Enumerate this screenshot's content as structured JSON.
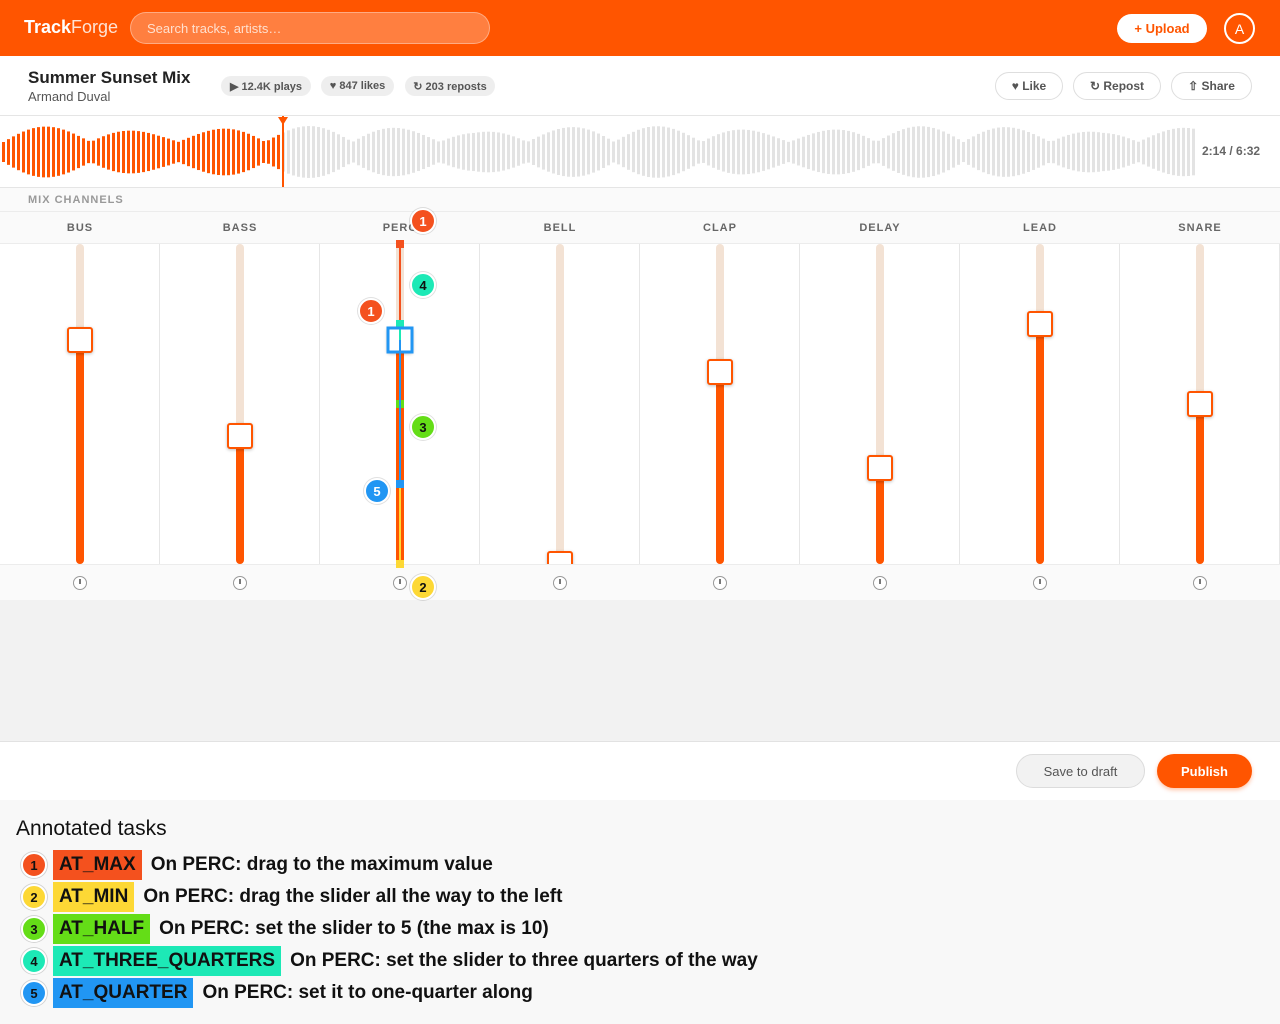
{
  "header": {
    "logo_bold": "Track",
    "logo_light": "Forge",
    "search_placeholder": "Search tracks, artists…",
    "upload_label": "+ Upload",
    "avatar_letter": "A"
  },
  "track": {
    "title": "Summer Sunset Mix",
    "artist": "Armand Duval",
    "plays": "▶ 12.4K plays",
    "likes": "♥ 847 likes",
    "reposts": "↻ 203 reposts",
    "actions": {
      "like": "♥ Like",
      "repost": "↻ Repost",
      "share": "⇧ Share"
    }
  },
  "waveform": {
    "time": "2:14 / 6:32",
    "progress": 0.352
  },
  "mix": {
    "section_label": "MIX CHANNELS",
    "channels": [
      {
        "name": "BUS",
        "level": 0.7
      },
      {
        "name": "BASS",
        "level": 0.4
      },
      {
        "name": "PERC",
        "level": 0.7
      },
      {
        "name": "BELL",
        "level": 0.0
      },
      {
        "name": "CLAP",
        "level": 0.6
      },
      {
        "name": "DELAY",
        "level": 0.3
      },
      {
        "name": "LEAD",
        "level": 0.75
      },
      {
        "name": "SNARE",
        "level": 0.5
      }
    ]
  },
  "footer": {
    "save_label": "Save to draft",
    "publish_label": "Publish"
  },
  "annotations": {
    "title": "Annotated tasks",
    "tasks": [
      {
        "num": "1",
        "tag": "AT_MAX",
        "text": "On PERC: drag to the maximum value",
        "color": "#f4511e",
        "target": 1.0
      },
      {
        "num": "2",
        "tag": "AT_MIN",
        "text": "On PERC: drag the slider all the way to the left",
        "color": "#fdd835",
        "target": 0.0
      },
      {
        "num": "3",
        "tag": "AT_HALF",
        "text": "On PERC: set the slider to 5 (the max is 10)",
        "color": "#64dd17",
        "target": 0.5
      },
      {
        "num": "4",
        "tag": "AT_THREE_QUARTERS",
        "text": "On PERC: set the slider to three quarters of the way",
        "color": "#1de9b6",
        "target": 0.75
      },
      {
        "num": "5",
        "tag": "AT_QUARTER",
        "text": "On PERC: set it to one-quarter along",
        "color": "#2196f3",
        "target": 0.25
      }
    ]
  }
}
